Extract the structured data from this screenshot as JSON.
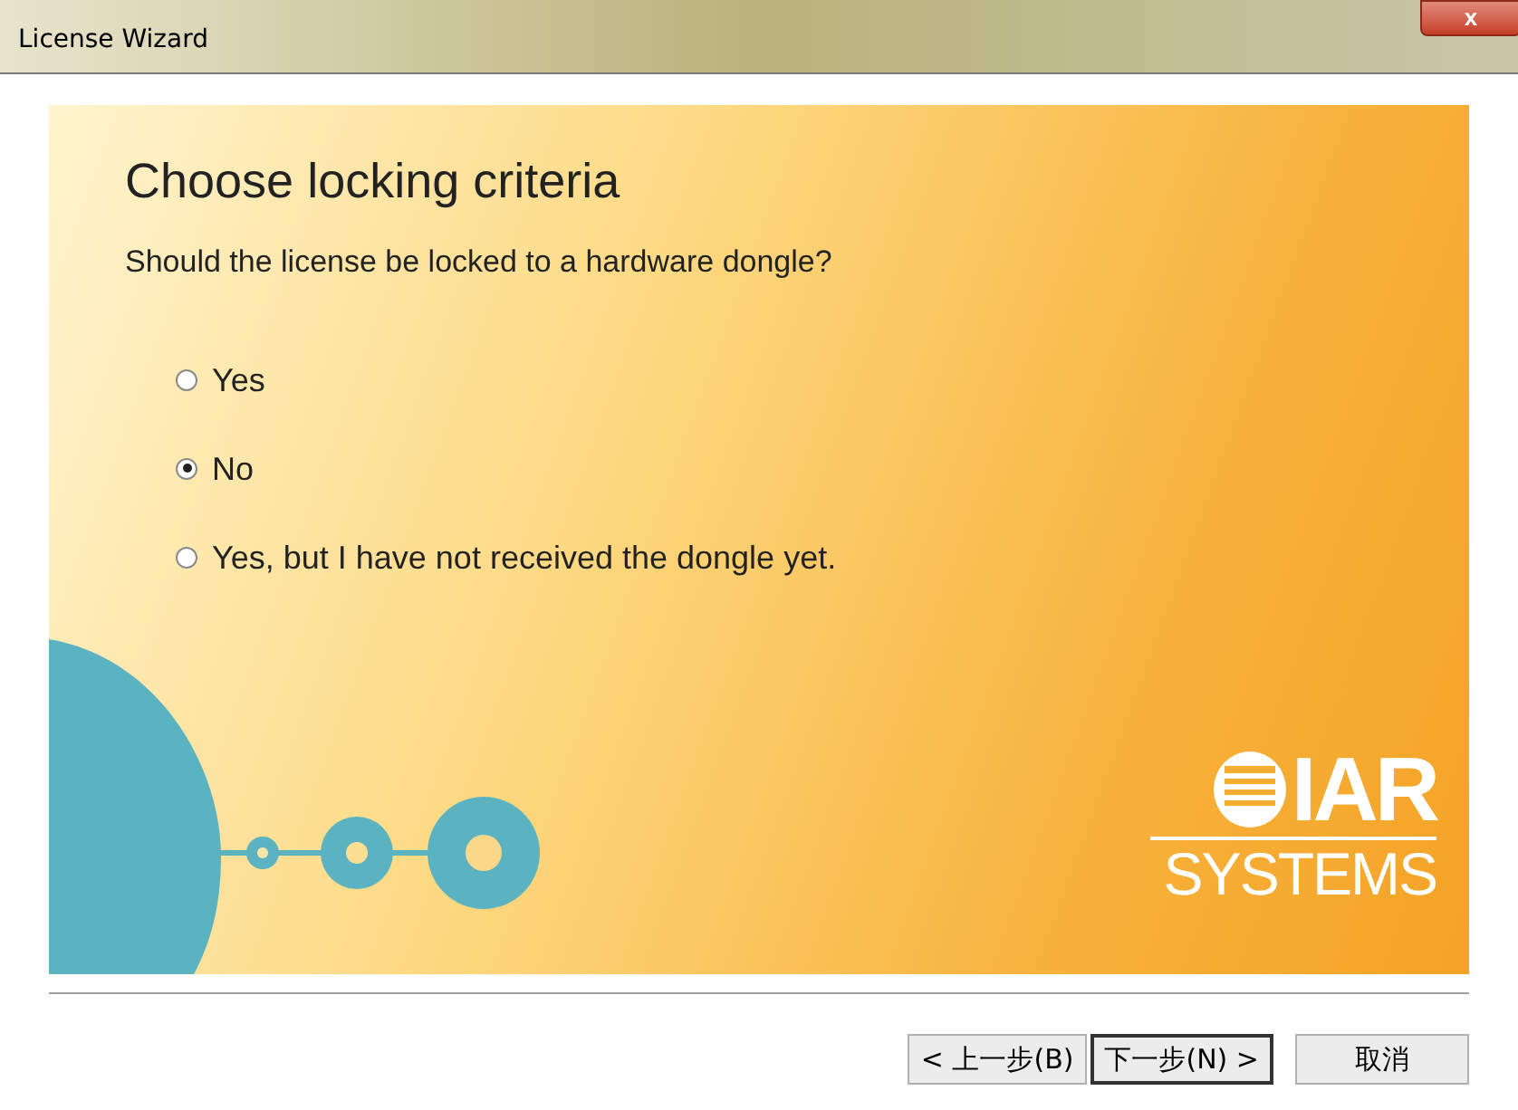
{
  "window": {
    "title": "License Wizard",
    "close": "x"
  },
  "page": {
    "heading": "Choose locking criteria",
    "question": "Should the license be locked to a hardware dongle?"
  },
  "options": [
    {
      "label": "Yes",
      "selected": false
    },
    {
      "label": "No",
      "selected": true
    },
    {
      "label": "Yes, but I have not received the dongle yet.",
      "selected": false
    }
  ],
  "logo": {
    "name": "IAR",
    "subtitle": "SYSTEMS"
  },
  "buttons": [
    {
      "label": "< 上一步(B)",
      "default": false
    },
    {
      "label": "下一步(N) >",
      "default": true
    },
    {
      "label": "取消",
      "default": false
    }
  ]
}
